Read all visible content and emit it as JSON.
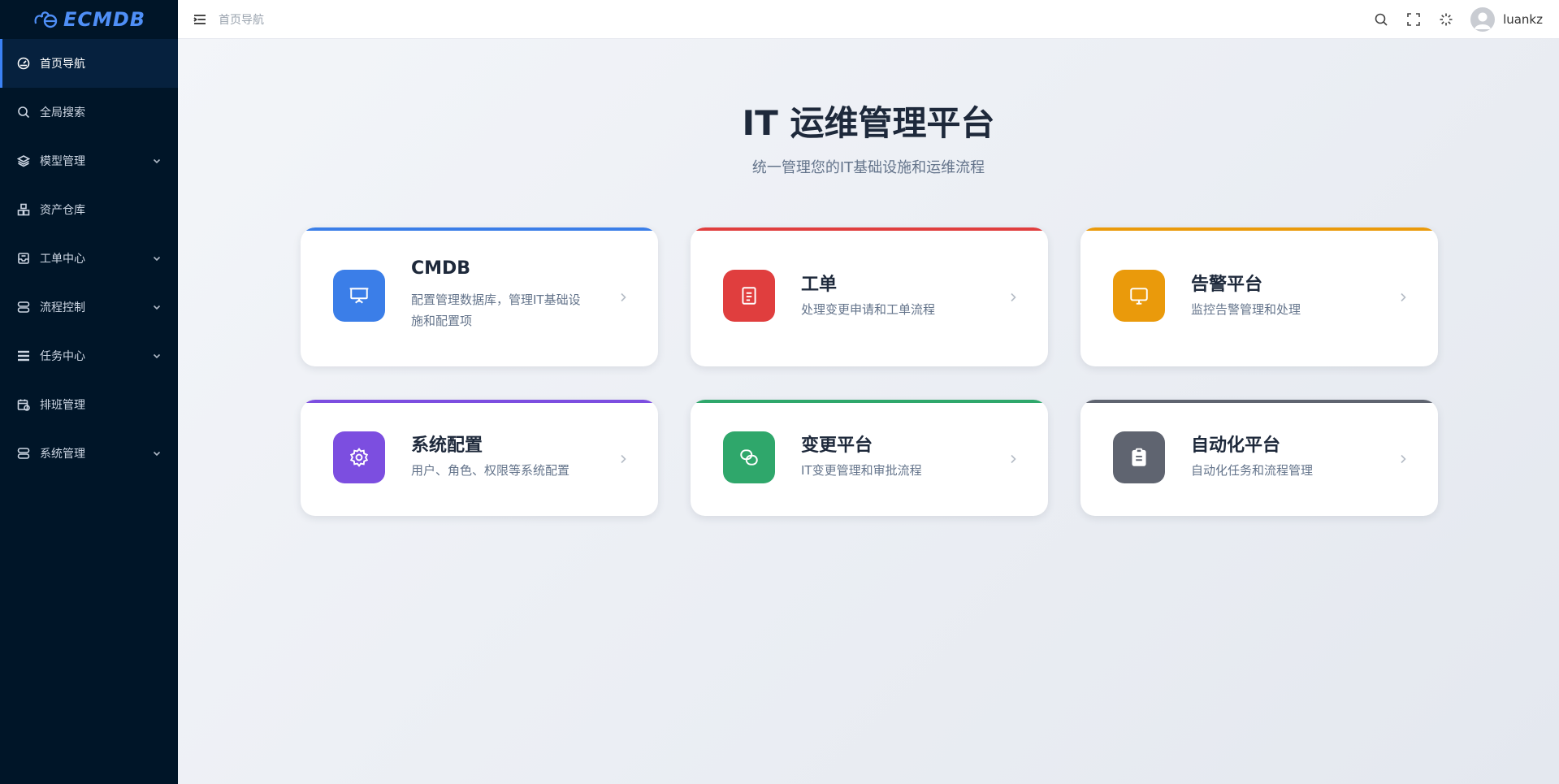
{
  "brand": {
    "name": "ECMDB",
    "color": "#4f8ff7"
  },
  "sidebar": {
    "items": [
      {
        "label": "首页导航",
        "icon": "dashboard-icon",
        "active": true,
        "expandable": false
      },
      {
        "label": "全局搜索",
        "icon": "search-icon",
        "active": false,
        "expandable": false
      },
      {
        "label": "模型管理",
        "icon": "layers-icon",
        "active": false,
        "expandable": true
      },
      {
        "label": "资产仓库",
        "icon": "boxes-icon",
        "active": false,
        "expandable": false
      },
      {
        "label": "工单中心",
        "icon": "inbox-icon",
        "active": false,
        "expandable": true
      },
      {
        "label": "流程控制",
        "icon": "server-icon",
        "active": false,
        "expandable": true
      },
      {
        "label": "任务中心",
        "icon": "list-icon",
        "active": false,
        "expandable": true
      },
      {
        "label": "排班管理",
        "icon": "calendar-icon",
        "active": false,
        "expandable": false
      },
      {
        "label": "系统管理",
        "icon": "server-icon",
        "active": false,
        "expandable": true
      }
    ]
  },
  "header": {
    "breadcrumb": "首页导航",
    "icons": [
      "search-icon",
      "fullscreen-icon",
      "loading-icon"
    ],
    "username": "luankz"
  },
  "main": {
    "title": "IT 运维管理平台",
    "subtitle": "统一管理您的IT基础设施和运维流程",
    "cards": [
      {
        "title": "CMDB",
        "desc": "配置管理数据库，管理IT基础设施和配置项",
        "icon": "presentation-icon",
        "color": "#3b7ee8"
      },
      {
        "title": "工单",
        "desc": "处理变更申请和工单流程",
        "icon": "document-icon",
        "color": "#e03e3e"
      },
      {
        "title": "告警平台",
        "desc": "监控告警管理和处理",
        "icon": "monitor-icon",
        "color": "#ea9a0b"
      },
      {
        "title": "系统配置",
        "desc": "用户、角色、权限等系统配置",
        "icon": "gear-icon",
        "color": "#7c4ee0"
      },
      {
        "title": "变更平台",
        "desc": "IT变更管理和审批流程",
        "icon": "link-icon",
        "color": "#2fa76b"
      },
      {
        "title": "自动化平台",
        "desc": "自动化任务和流程管理",
        "icon": "clipboard-icon",
        "color": "#5f6470"
      }
    ]
  }
}
